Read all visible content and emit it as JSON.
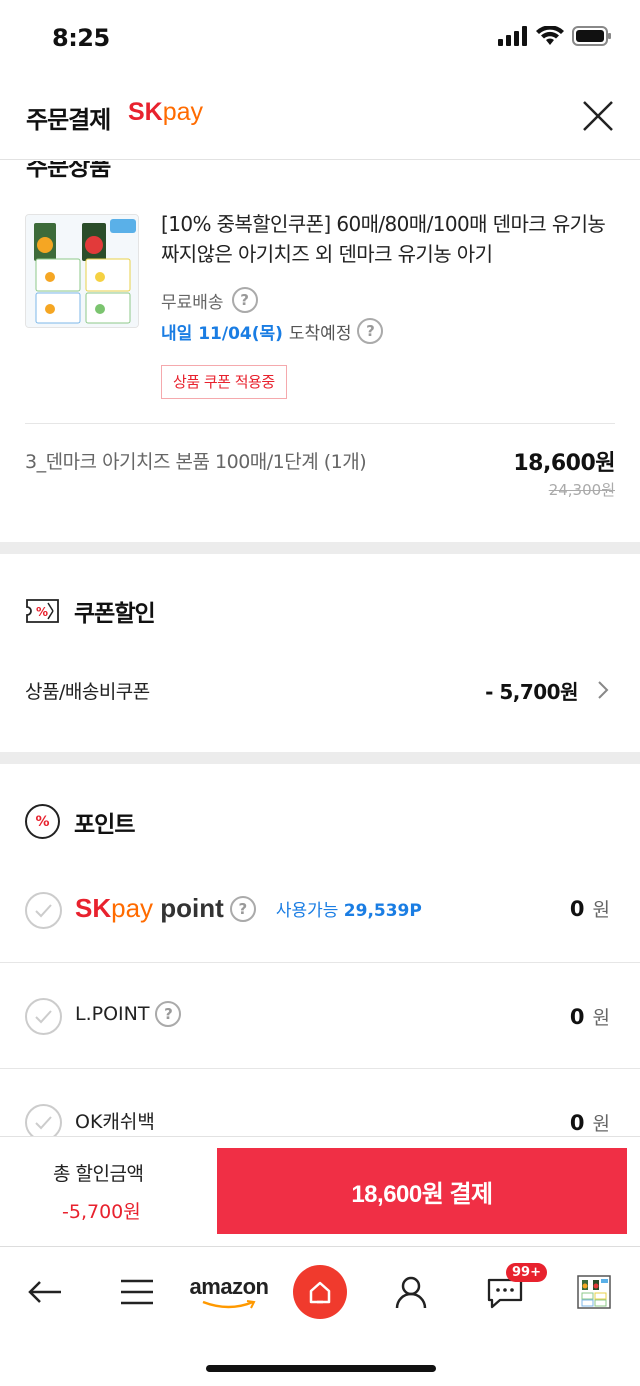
{
  "status_bar": {
    "time": "8:25"
  },
  "header": {
    "title": "주문결제",
    "logo_sk": "SK",
    "logo_pay": "pay"
  },
  "order": {
    "section_title": "주문상품",
    "product_name": "[10% 중복할인쿠폰] 60매/80매/100매 덴마크 유기농 짜지않은 아기치즈 외 덴마크 유기농 아기",
    "shipping": "무료배송",
    "arrival_date": "내일 11/04(목)",
    "arrival_suffix": "도착예정",
    "coupon_badge": "상품 쿠폰 적용중",
    "option": "3_덴마크 아기치즈 본품 100매/1단계 (1개)",
    "price": "18,600원",
    "original_price": "24,300원"
  },
  "coupon": {
    "title": "쿠폰할인",
    "row_label": "상품/배송비쿠폰",
    "row_amount": "- 5,700원"
  },
  "points": {
    "title": "포인트",
    "items": [
      {
        "name_sk": "SK",
        "name_pay": "pay",
        "name_point": "point",
        "available_label": "사용가능",
        "available_value": "29,539P",
        "value": "0",
        "unit": "원"
      },
      {
        "name": "L.POINT",
        "value": "0",
        "unit": "원"
      },
      {
        "name": "OK캐쉬백",
        "value": "0",
        "unit": "원"
      }
    ]
  },
  "footer": {
    "total_label": "총 할인금액",
    "total_value": "-5,700원",
    "pay_button": "18,600원 결제"
  },
  "nav": {
    "amazon": "amazon",
    "badge": "99+"
  },
  "colors": {
    "brand_red": "#e8222e",
    "pay_orange": "#ff6b00",
    "link_blue": "#1a7de3",
    "cta": "#f02f45"
  }
}
